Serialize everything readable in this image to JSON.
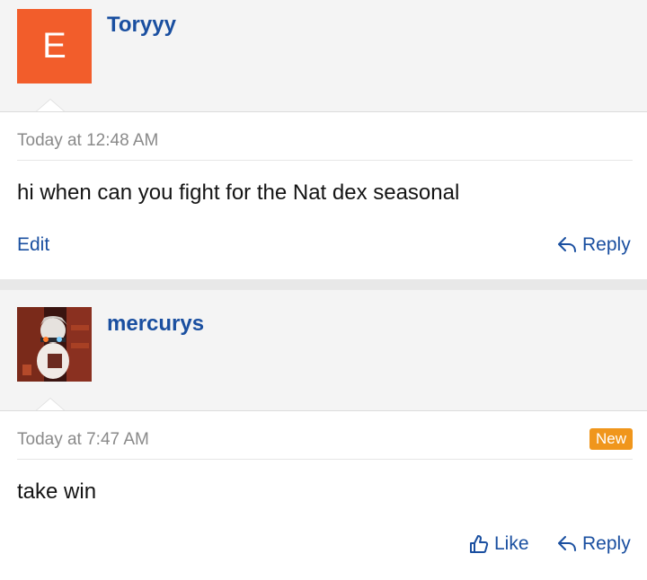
{
  "posts": [
    {
      "avatar_letter": "E",
      "username": "Toryyy",
      "timestamp": "Today at 12:48 AM",
      "message": "hi when can you fight for the Nat dex seasonal",
      "edit_label": "Edit",
      "reply_label": "Reply"
    },
    {
      "username": "mercurys",
      "timestamp": "Today at 7:47 AM",
      "badge": "New",
      "message": "take win",
      "like_label": "Like",
      "reply_label": "Reply"
    }
  ],
  "colors": {
    "link": "#1a4fa0",
    "avatar_orange": "#f25d2b",
    "badge_orange": "#f0961c"
  },
  "icons": [
    "reply-icon",
    "like-icon"
  ]
}
